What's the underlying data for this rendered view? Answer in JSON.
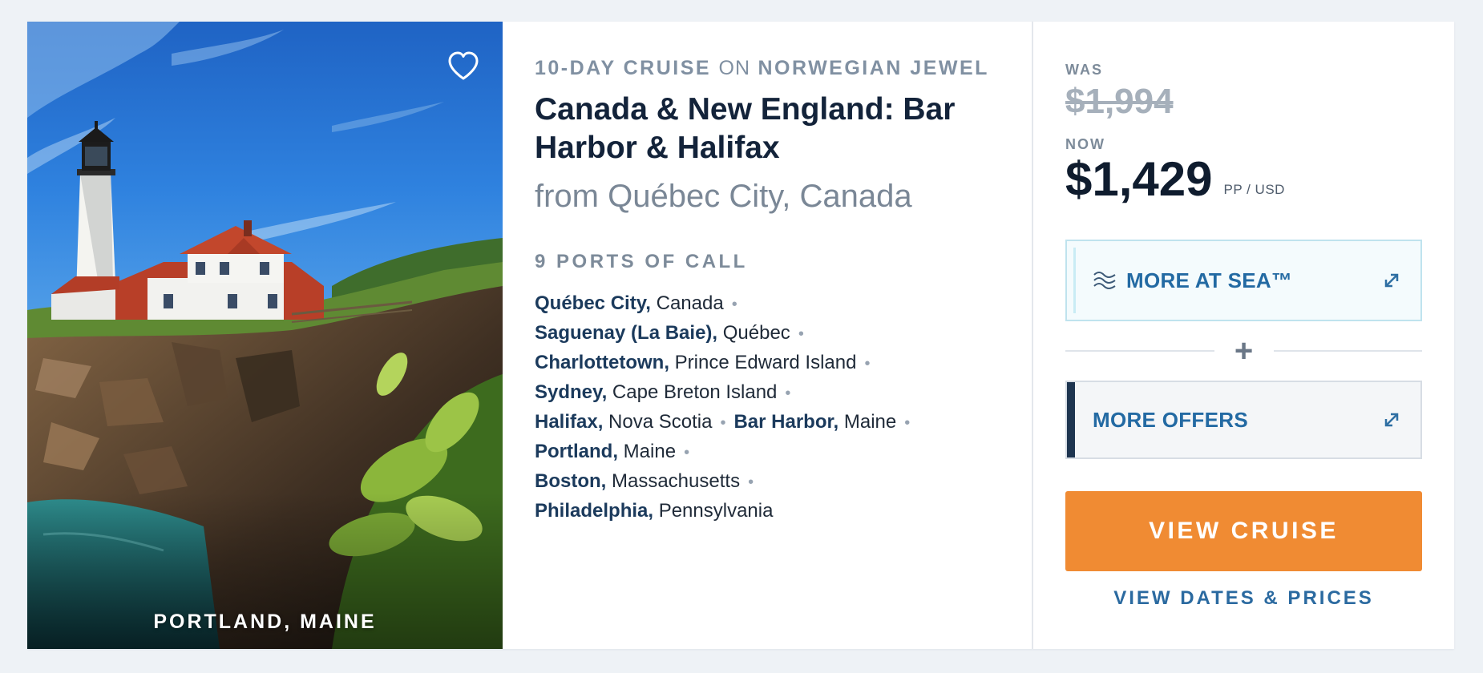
{
  "image": {
    "caption": "PORTLAND, MAINE",
    "favorite_icon": "heart-outline-icon"
  },
  "details": {
    "kicker_duration": "10-DAY CRUISE",
    "kicker_on": "ON",
    "kicker_ship": "NORWEGIAN JEWEL",
    "title": "Canada & New England: Bar Harbor & Halifax",
    "departure": "from Québec City, Canada",
    "ports_heading": "9 PORTS OF CALL",
    "port_lines": [
      [
        {
          "city": "Québec City,",
          "region": "Canada"
        }
      ],
      [
        {
          "city": "Saguenay (La Baie),",
          "region": "Québec"
        }
      ],
      [
        {
          "city": "Charlottetown,",
          "region": "Prince Edward Island"
        }
      ],
      [
        {
          "city": "Sydney,",
          "region": "Cape Breton Island"
        }
      ],
      [
        {
          "city": "Halifax,",
          "region": "Nova Scotia"
        },
        {
          "city": "Bar Harbor,",
          "region": "Maine"
        }
      ],
      [
        {
          "city": "Portland,",
          "region": "Maine"
        }
      ],
      [
        {
          "city": "Boston,",
          "region": "Massachusetts"
        }
      ],
      [
        {
          "city": "Philadelphia,",
          "region": "Pennsylvania"
        }
      ]
    ],
    "separator": "•"
  },
  "pricing": {
    "was_label": "WAS",
    "was_price": "$1,994",
    "now_label": "NOW",
    "now_price": "$1,429",
    "unit": "PP / USD"
  },
  "offers": {
    "more_at_sea_label": "MORE AT SEA™",
    "more_at_sea_icon": "waves-icon",
    "plus": "+",
    "more_offers_label": "MORE OFFERS",
    "expand_icon": "expand-arrow-icon"
  },
  "actions": {
    "view_cruise": "VIEW CRUISE",
    "view_dates": "VIEW DATES & PRICES"
  },
  "colors": {
    "accent_orange": "#f08b33",
    "link_blue": "#2b6aa0",
    "navy": "#13233a",
    "muted": "#7d8b9a"
  }
}
